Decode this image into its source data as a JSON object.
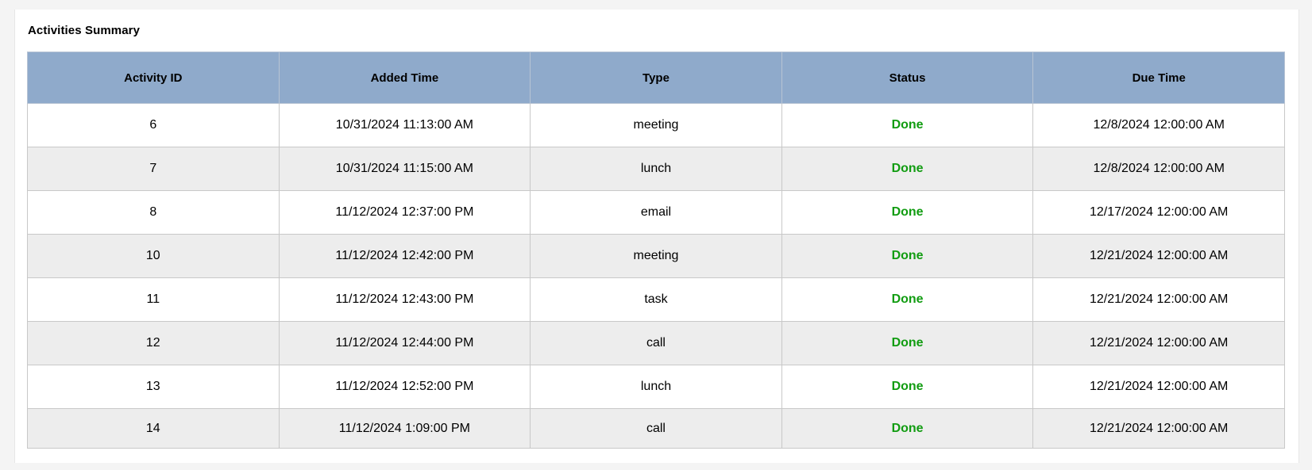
{
  "panel": {
    "title": "Activities Summary"
  },
  "table": {
    "columns": [
      "Activity ID",
      "Added Time",
      "Type",
      "Status",
      "Due Time"
    ],
    "rows": [
      {
        "id": "6",
        "added": "10/31/2024 11:13:00 AM",
        "type": "meeting",
        "status": "Done",
        "due": "12/8/2024 12:00:00 AM"
      },
      {
        "id": "7",
        "added": "10/31/2024 11:15:00 AM",
        "type": "lunch",
        "status": "Done",
        "due": "12/8/2024 12:00:00 AM"
      },
      {
        "id": "8",
        "added": "11/12/2024 12:37:00 PM",
        "type": "email",
        "status": "Done",
        "due": "12/17/2024 12:00:00 AM"
      },
      {
        "id": "10",
        "added": "11/12/2024 12:42:00 PM",
        "type": "meeting",
        "status": "Done",
        "due": "12/21/2024 12:00:00 AM"
      },
      {
        "id": "11",
        "added": "11/12/2024 12:43:00 PM",
        "type": "task",
        "status": "Done",
        "due": "12/21/2024 12:00:00 AM"
      },
      {
        "id": "12",
        "added": "11/12/2024 12:44:00 PM",
        "type": "call",
        "status": "Done",
        "due": "12/21/2024 12:00:00 AM"
      },
      {
        "id": "13",
        "added": "11/12/2024 12:52:00 PM",
        "type": "lunch",
        "status": "Done",
        "due": "12/21/2024 12:00:00 AM"
      },
      {
        "id": "14",
        "added": "11/12/2024 1:09:00 PM",
        "type": "call",
        "status": "Done",
        "due": "12/21/2024 12:00:00 AM"
      }
    ]
  },
  "colors": {
    "header_bg": "#8faacb",
    "status_done": "#119c11",
    "row_alt": "#ededed"
  }
}
